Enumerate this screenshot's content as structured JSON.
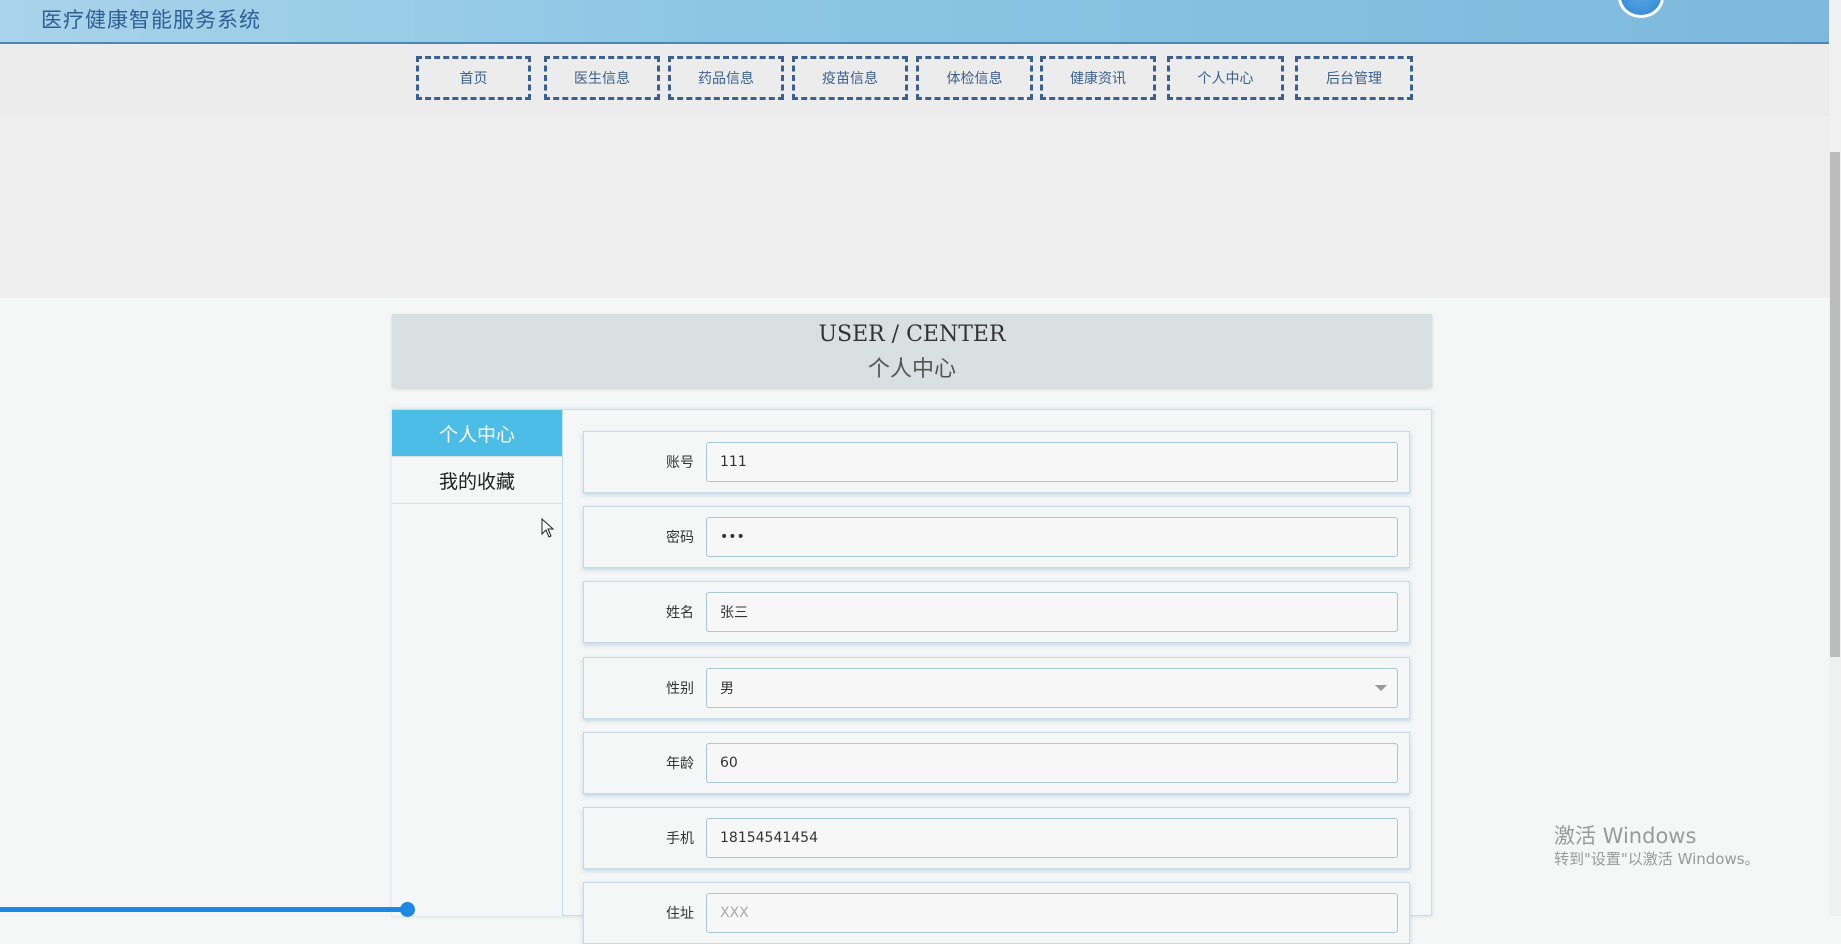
{
  "header": {
    "site_title": "医疗健康智能服务系统"
  },
  "nav": [
    {
      "label": "首页"
    },
    {
      "label": "医生信息"
    },
    {
      "label": "药品信息"
    },
    {
      "label": "疫苗信息"
    },
    {
      "label": "体检信息"
    },
    {
      "label": "健康资讯"
    },
    {
      "label": "个人中心"
    },
    {
      "label": "后台管理"
    }
  ],
  "section": {
    "title_en": "USER / CENTER",
    "title_cn": "个人中心"
  },
  "sidebar": {
    "items": [
      {
        "label": "个人中心",
        "active": true
      },
      {
        "label": "我的收藏",
        "active": false
      }
    ]
  },
  "form": {
    "rows": [
      {
        "label": "账号",
        "value": "111"
      },
      {
        "label": "密码",
        "value": "•••"
      },
      {
        "label": "姓名",
        "value": "张三"
      },
      {
        "label": "性别",
        "value": "男"
      },
      {
        "label": "年龄",
        "value": "60"
      },
      {
        "label": "手机",
        "value": "18154541454"
      },
      {
        "label": "住址",
        "placeholder": "XXX"
      }
    ]
  },
  "watermark": {
    "line1": "激活 Windows",
    "line2": "转到\"设置\"以激活 Windows。"
  },
  "colors": {
    "header_bg": "#8cc6e4",
    "nav_border": "#3b5f8f",
    "active_tab": "#4bbde6"
  }
}
